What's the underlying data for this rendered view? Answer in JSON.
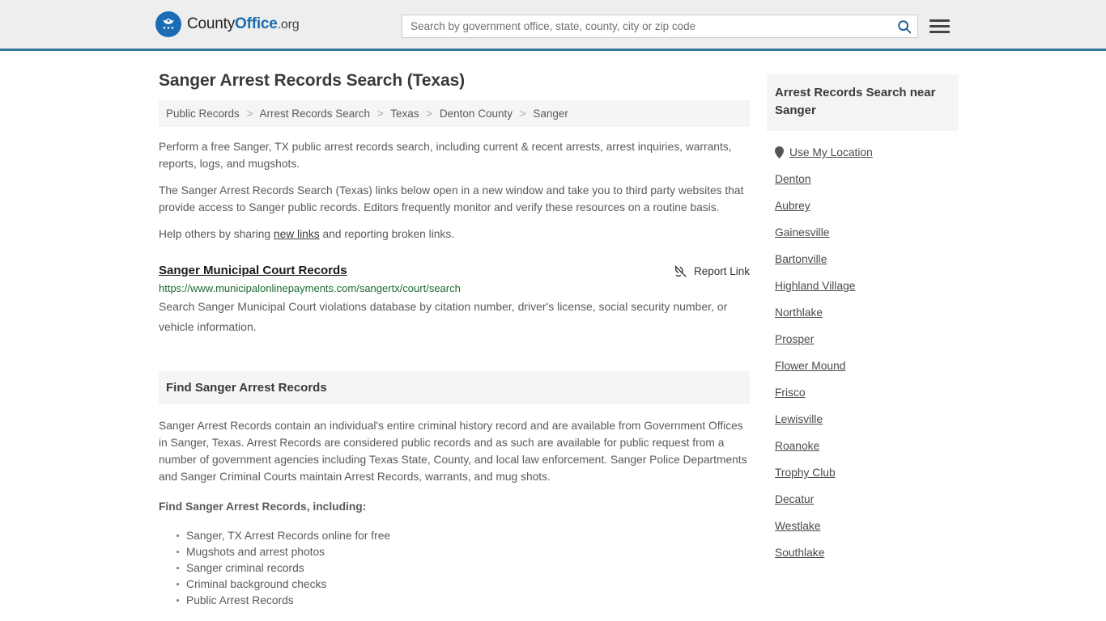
{
  "header": {
    "logo": {
      "icon": "eagle-seal-icon",
      "part1": "County",
      "part2": "Office",
      "part3": ".org"
    },
    "search": {
      "placeholder": "Search by government office, state, county, city or zip code",
      "value": "",
      "icon": "search-icon"
    },
    "menu_icon": "hamburger-menu-icon",
    "accent_color": "#37739f",
    "background_color": "#eeeeee"
  },
  "main": {
    "title": "Sanger Arrest Records Search (Texas)",
    "breadcrumb": [
      "Public Records",
      "Arrest Records Search",
      "Texas",
      "Denton County",
      "Sanger"
    ],
    "breadcrumb_separator": ">",
    "intro_paragraphs": [
      "Perform a free Sanger, TX public arrest records search, including current & recent arrests, arrest inquiries, warrants, reports, logs, and mugshots.",
      "The Sanger Arrest Records Search (Texas) links below open in a new window and take you to third party websites that provide access to Sanger public records. Editors frequently monitor and verify these resources on a routine basis."
    ],
    "help_line": {
      "before": "Help others by sharing ",
      "link": "new links",
      "after": " and reporting broken links."
    },
    "result": {
      "title": "Sanger Municipal Court Records",
      "url": "https://www.municipalonlinepayments.com/sangertx/court/search",
      "description": "Search Sanger Municipal Court violations database by citation number, driver's license, social security number, or vehicle information.",
      "report_label": "Report Link",
      "report_icon": "unlink-icon",
      "url_color": "#1d6b33"
    },
    "section": {
      "heading": "Find Sanger Arrest Records",
      "paragraph": "Sanger Arrest Records contain an individual's entire criminal history record and are available from Government Offices in Sanger, Texas. Arrest Records are considered public records and as such are available for public request from a number of government agencies including Texas State, County, and local law enforcement. Sanger Police Departments and Sanger Criminal Courts maintain Arrest Records, warrants, and mug shots.",
      "subheading": "Find Sanger Arrest Records, including:",
      "bullets": [
        "Sanger, TX Arrest Records online for free",
        "Mugshots and arrest photos",
        "Sanger criminal records",
        "Criminal background checks",
        "Public Arrest Records"
      ]
    }
  },
  "sidebar": {
    "heading": "Arrest Records Search near Sanger",
    "use_my_location": {
      "label": "Use My Location",
      "icon": "map-pin-icon"
    },
    "cities": [
      "Denton",
      "Aubrey",
      "Gainesville",
      "Bartonville",
      "Highland Village",
      "Northlake",
      "Prosper",
      "Flower Mound",
      "Frisco",
      "Lewisville",
      "Roanoke",
      "Trophy Club",
      "Decatur",
      "Westlake",
      "Southlake"
    ]
  }
}
